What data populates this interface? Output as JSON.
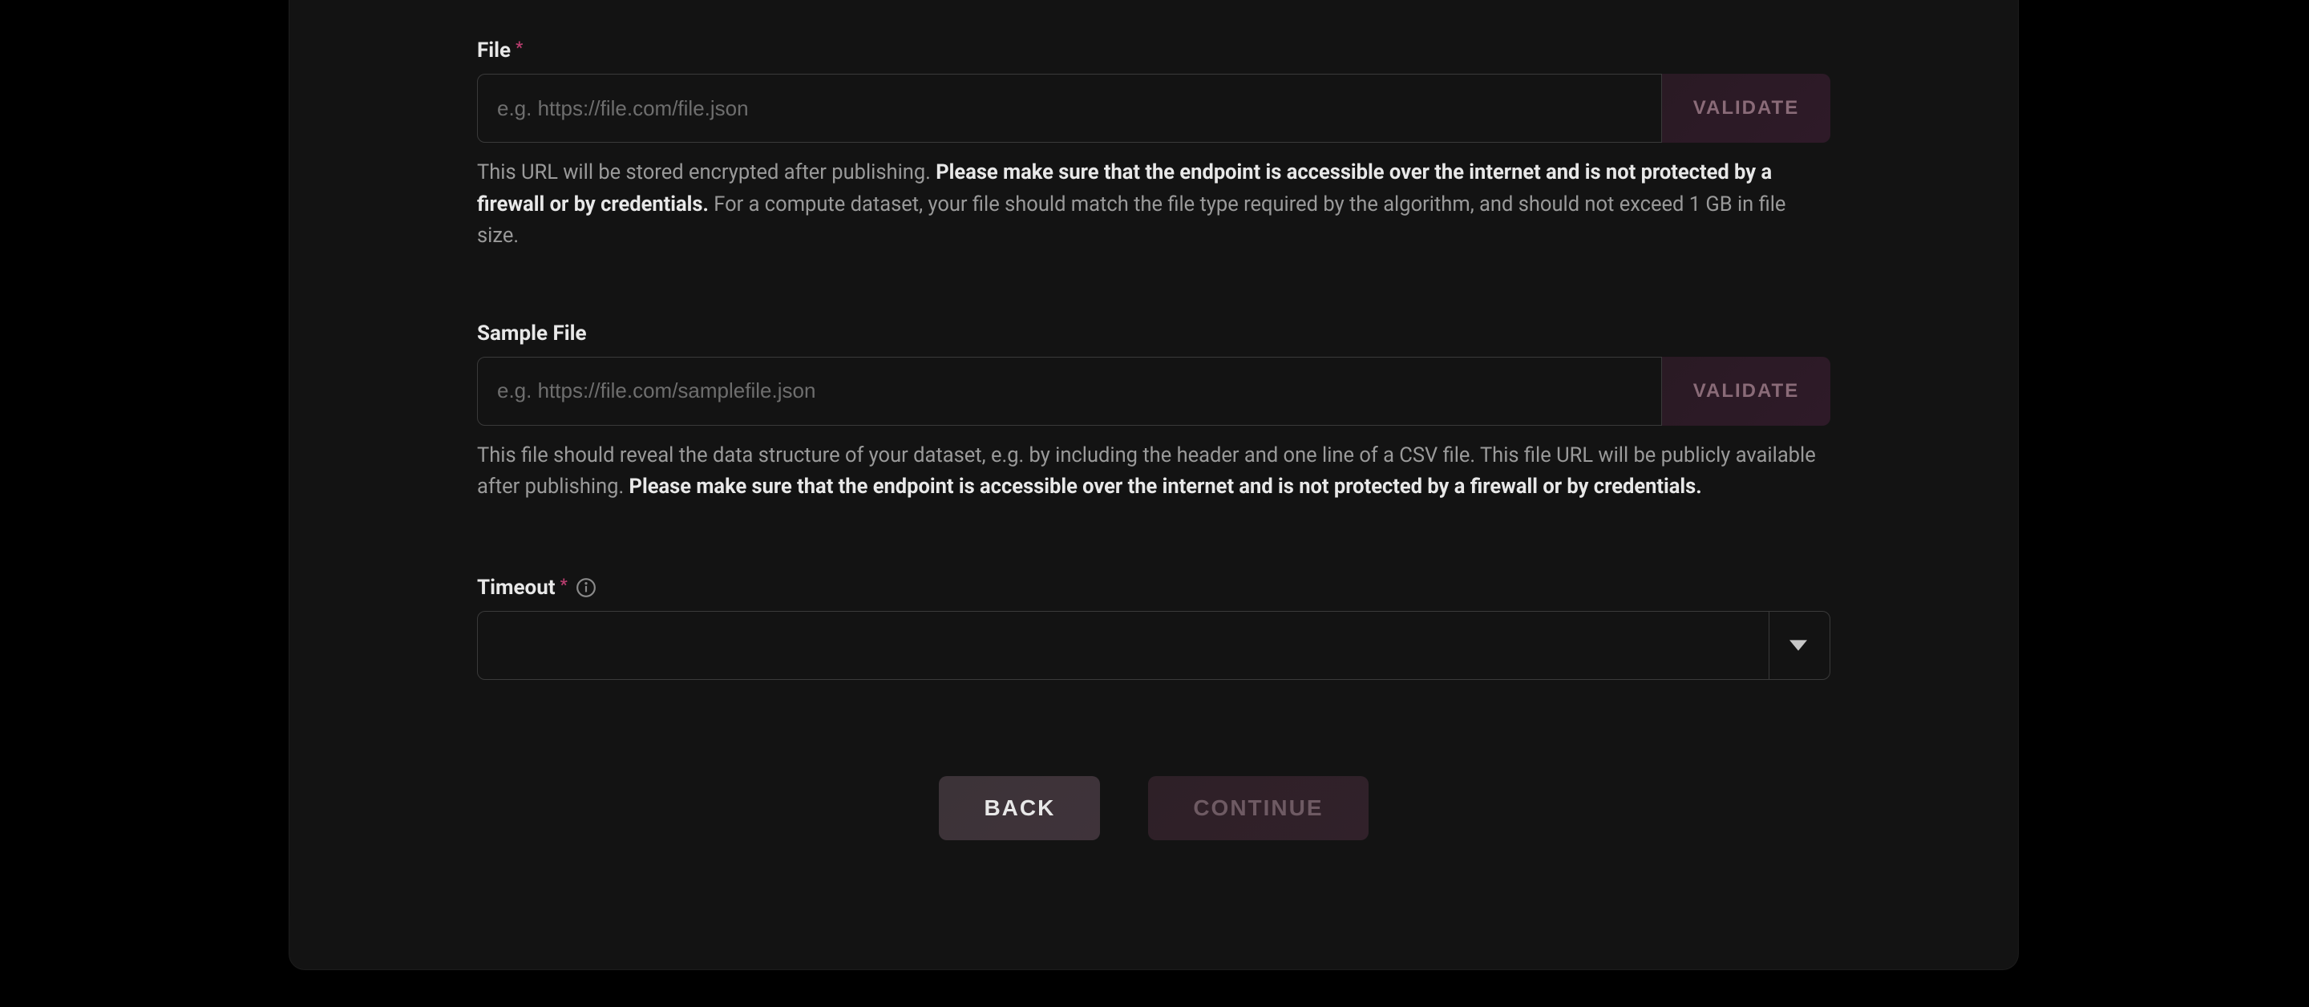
{
  "fields": {
    "file": {
      "label": "File",
      "required": true,
      "placeholder": "e.g. https://file.com/file.json",
      "validate_label": "VALIDATE",
      "help_prefix": "This URL will be stored encrypted after publishing. ",
      "help_bold": "Please make sure that the endpoint is accessible over the internet and is not protected by a firewall or by credentials.",
      "help_suffix": " For a compute dataset, your file should match the file type required by the algorithm, and should not exceed 1 GB in file size."
    },
    "sample_file": {
      "label": "Sample File",
      "required": false,
      "placeholder": "e.g. https://file.com/samplefile.json",
      "validate_label": "VALIDATE",
      "help_prefix": "This file should reveal the data structure of your dataset, e.g. by including the header and one line of a CSV file. This file URL will be publicly available after publishing. ",
      "help_bold": "Please make sure that the endpoint is accessible over the internet and is not protected by a firewall or by credentials.",
      "help_suffix": ""
    },
    "timeout": {
      "label": "Timeout",
      "required": true
    }
  },
  "buttons": {
    "back": "BACK",
    "continue": "CONTINUE"
  }
}
